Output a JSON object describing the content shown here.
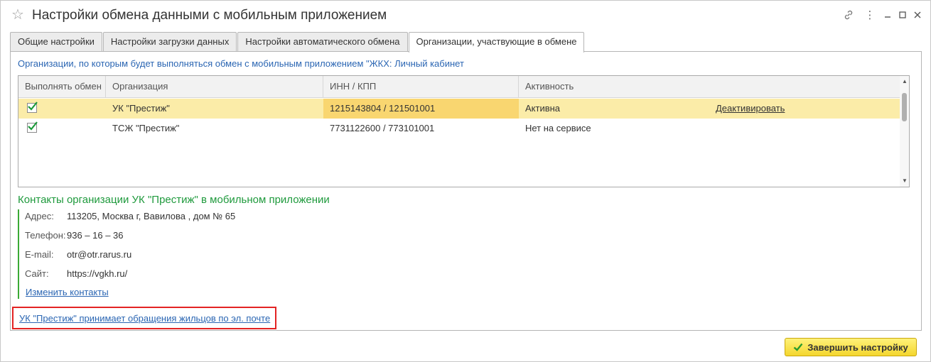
{
  "window": {
    "title": "Настройки обмена данными с мобильным приложением"
  },
  "tabs": [
    {
      "label": "Общие настройки"
    },
    {
      "label": "Настройки загрузки данных"
    },
    {
      "label": "Настройки автоматического обмена"
    },
    {
      "label": "Организации, участвующие в обмене"
    }
  ],
  "organizations": {
    "caption": "Организации, по которым будет выполняться обмен с мобильным приложением  \"ЖКХ: Личный кабинет",
    "columns": [
      "Выполнять обмен",
      "Организация",
      "ИНН / КПП",
      "Активность"
    ],
    "rows": [
      {
        "exchange": true,
        "org": "УК \"Престиж\"",
        "inn_kpp": "1215143804 / 121501001",
        "activity": "Активна",
        "action": "Деактивировать"
      },
      {
        "exchange": true,
        "org": "ТСЖ \"Престиж\"",
        "inn_kpp": "7731122600 / 773101001",
        "activity": "Нет на сервисе",
        "action": ""
      }
    ]
  },
  "contacts": {
    "title": "Контакты организации УК \"Престиж\" в мобильном приложении",
    "address_label": "Адрес:",
    "address": "113205, Москва г, Вавилова , дом № 65",
    "phone_label": "Телефон:",
    "phone": "936 – 16 – 36",
    "email_label": "E-mail:",
    "email": "otr@otr.rarus.ru",
    "site_label": "Сайт:",
    "site": "https://vgkh.ru/",
    "change_link": "Изменить контакты"
  },
  "email_requests_link": "УК \"Престиж\" принимает обращения жильцов по эл. почте",
  "finish_button": "Завершить настройку",
  "colors": {
    "link_blue": "#2b66b3",
    "contacts_green": "#1f9a3d",
    "selected_row": "#fbeca8",
    "highlight_cell": "#f9d670",
    "callout_red": "#e32323",
    "button_yellow": "#f4d62e"
  }
}
